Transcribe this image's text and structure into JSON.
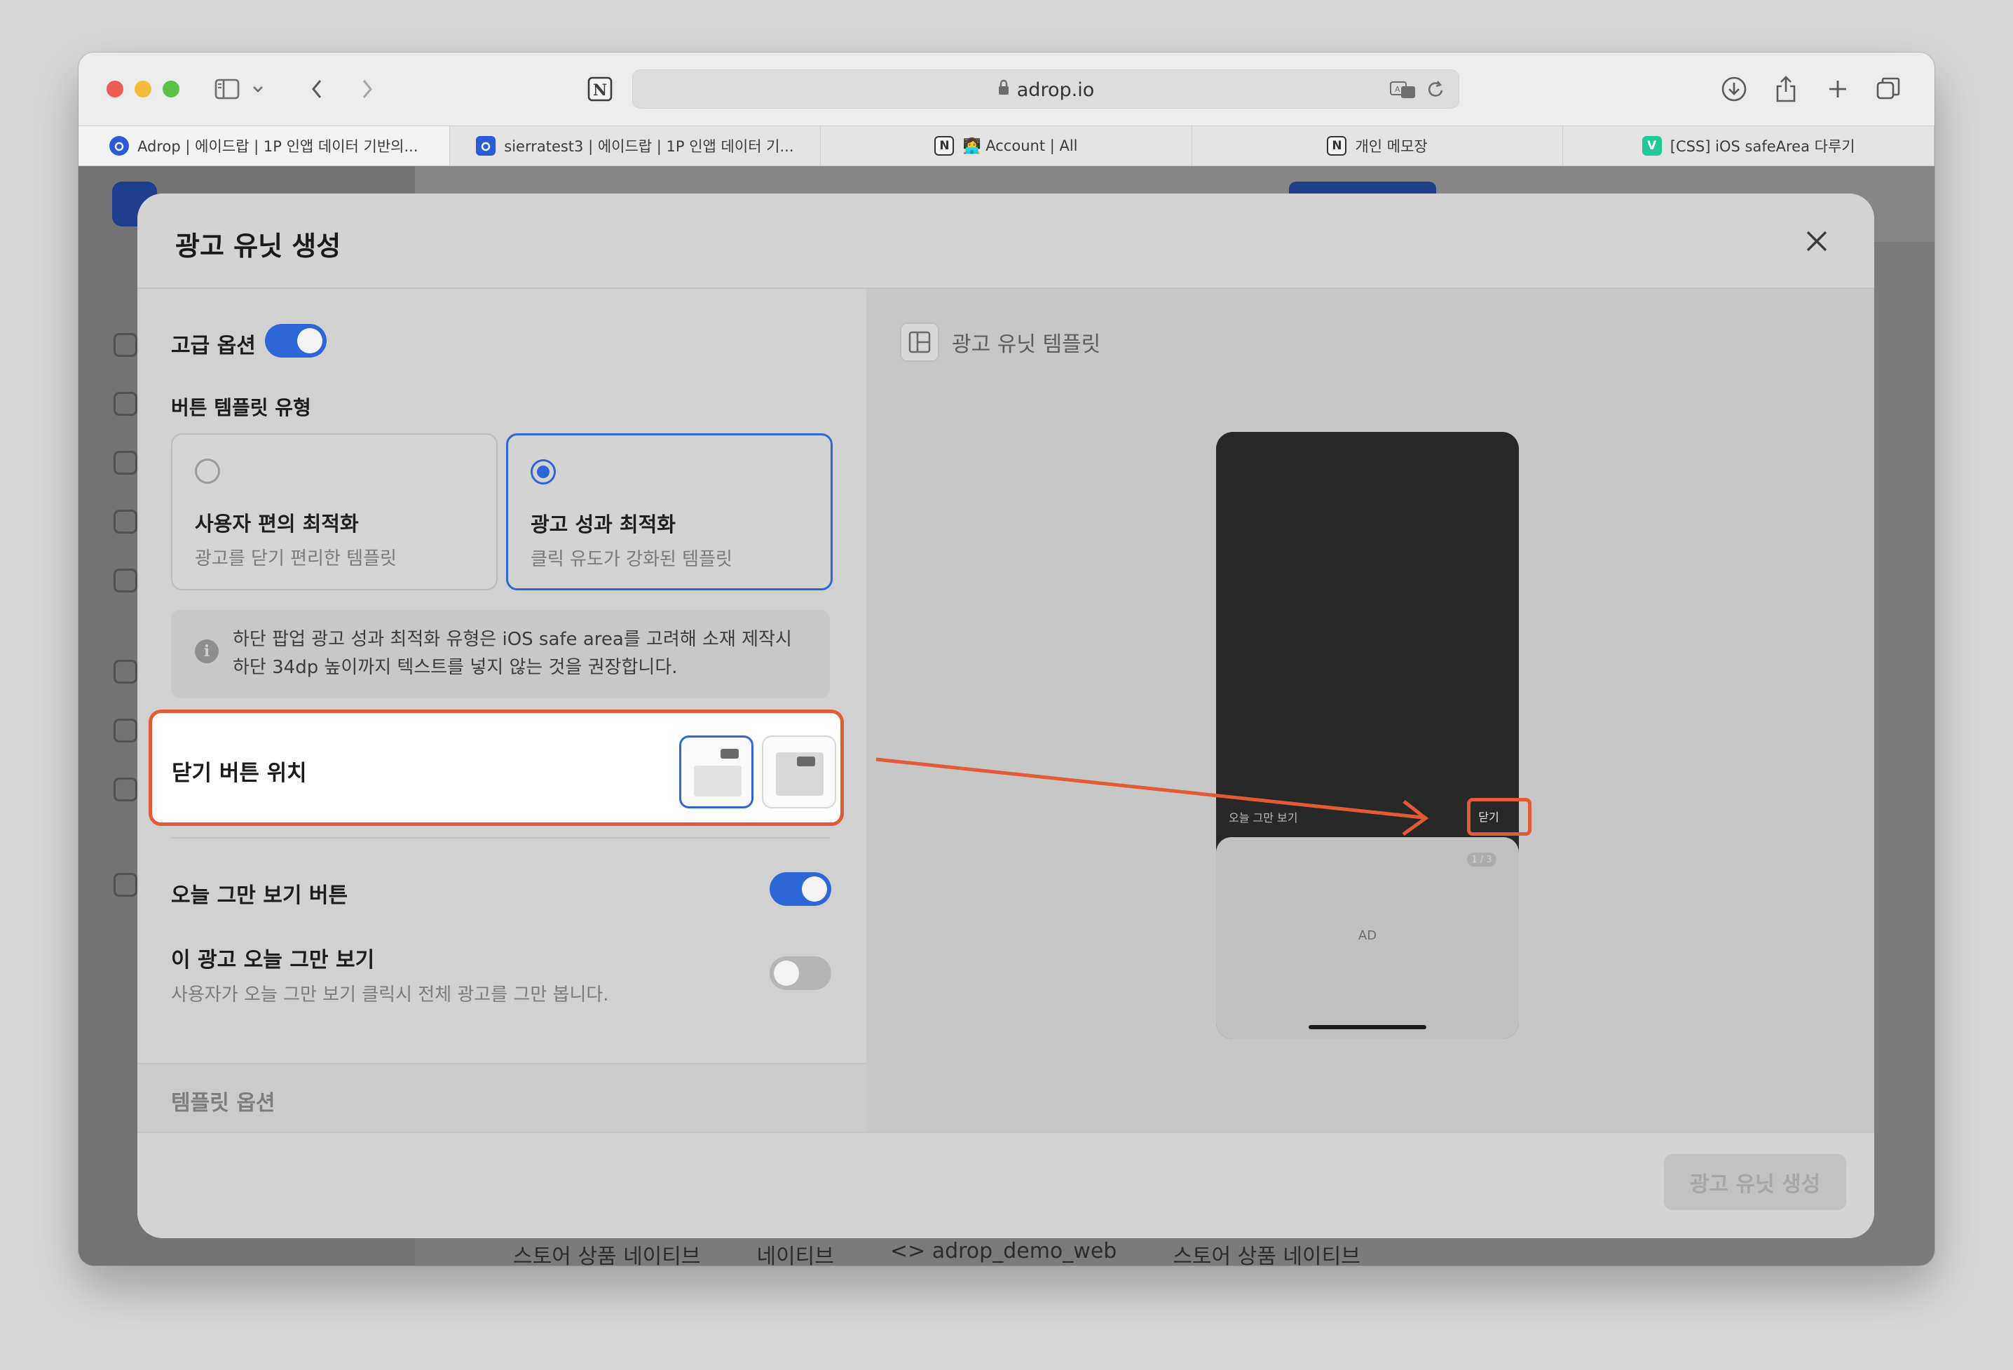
{
  "browser": {
    "url": "adrop.io",
    "tabs": [
      {
        "title": "Adrop | 에이드랍 | 1P 인앱 데이터 기반의...",
        "favicon": "adrop",
        "active": true
      },
      {
        "title": "sierratest3 | 에이드랍 | 1P 인앱 데이터 기...",
        "favicon": "adrop",
        "active": false
      },
      {
        "title": "👩‍💻 Account | All",
        "favicon": "notion",
        "active": false
      },
      {
        "title": "개인 메모장",
        "favicon": "notion",
        "active": false
      },
      {
        "title": "[CSS] iOS safeArea 다루기",
        "favicon": "velog",
        "active": false
      }
    ],
    "favicon_letters": {
      "notion": "N",
      "velog": "V"
    }
  },
  "background_page": {
    "bottom_row": [
      "스토어 상품 네이티브",
      "네이티브",
      "<> adrop_demo_web",
      "스토어 상품 네이티브"
    ]
  },
  "modal": {
    "title": "광고 유닛 생성",
    "advanced_option": {
      "label": "고급 옵션",
      "enabled": true
    },
    "button_template": {
      "label": "버튼 템플릿 유형",
      "options": [
        {
          "title": "사용자 편의 최적화",
          "desc": "광고를 닫기 편리한 템플릿",
          "selected": false
        },
        {
          "title": "광고 성과 최적화",
          "desc": "클릭 유도가 강화된 템플릿",
          "selected": true
        }
      ]
    },
    "info": {
      "line1": "하단 팝업 광고 성과 최적화 유형은 iOS safe area를 고려해 소재 제작시",
      "line2": "하단 34dp 높이까지 텍스트를 넣지 않는 것을 권장합니다."
    },
    "close_button_position": {
      "label": "닫기 버튼 위치",
      "options": [
        {
          "name": "top-right-outside",
          "selected": true
        },
        {
          "name": "top-right-inside",
          "selected": false
        }
      ]
    },
    "hide_today_button": {
      "label": "오늘 그만 보기 버튼",
      "enabled": true
    },
    "hide_ad_today": {
      "label": "이 광고 오늘 그만 보기",
      "desc": "사용자가 오늘 그만 보기 클릭시 전체 광고를 그만 봅니다.",
      "enabled": false
    },
    "template_options_label": "템플릿 옵션",
    "preview": {
      "header": "광고 유닛 템플릿",
      "today_text": "오늘 그만 보기",
      "close_text": "닫기",
      "page_indicator": "1 / 3",
      "ad_text": "AD"
    },
    "create_button": "광고 유닛 생성"
  },
  "colors": {
    "accent": "#2d66d6",
    "annotation": "#e25a36",
    "adrop_brand": "#2b5bd7",
    "velog": "#20c997"
  }
}
